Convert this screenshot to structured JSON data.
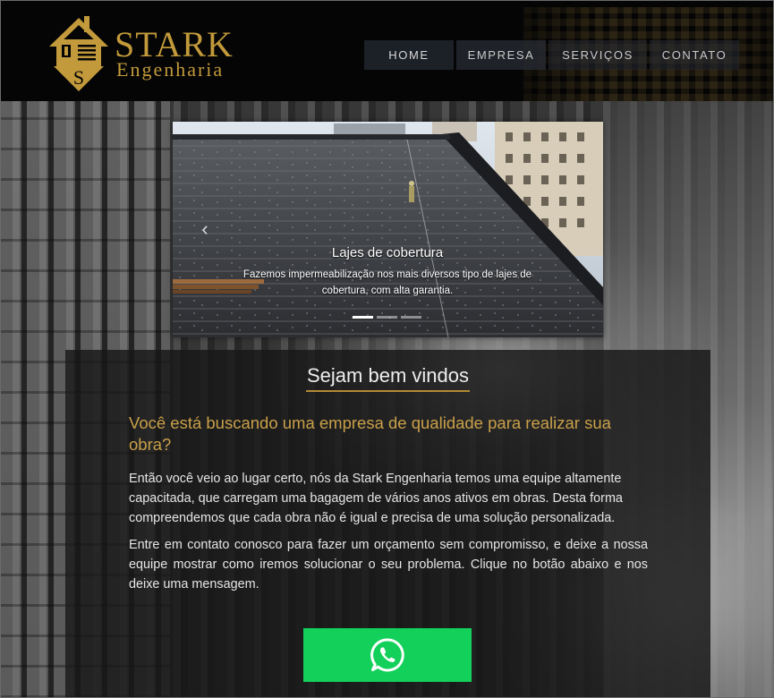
{
  "brand": {
    "name": "STARK",
    "subtitle": "Engenharia",
    "logo_letter": "S",
    "color_gold": "#c29a3b"
  },
  "nav": {
    "items": [
      {
        "label": "HOME"
      },
      {
        "label": "EMPRESA"
      },
      {
        "label": "SERVIÇOS"
      },
      {
        "label": "CONTATO"
      }
    ]
  },
  "carousel": {
    "slide_title": "Lajes de cobertura",
    "slide_text": "Fazemos impermeabilização nos mais diversos tipo de lajes de cobertura, com alta garantia.",
    "prev_icon": "chevron-left-icon",
    "indicator_count": 3,
    "active_index": 0
  },
  "welcome": {
    "heading": "Sejam bem vindos",
    "question": "Você está buscando uma empresa de qualidade para realizar sua obra?",
    "paragraph1": "Então você veio ao lugar certo, nós da Stark Engenharia temos uma equipe altamente capacitada, que carregam uma bagagem de vários anos ativos em obras. Desta forma compreendemos que cada obra não é igual e precisa de uma solução personalizada.",
    "paragraph2": "Entre em contato conosco para fazer um orçamento sem compromisso, e deixe a nossa equipe mostrar como iremos solucionar o seu problema. Clique no botão abaixo e nos deixe uma mensagem."
  },
  "cta": {
    "icon": "whatsapp-icon",
    "color": "#13d05a"
  }
}
